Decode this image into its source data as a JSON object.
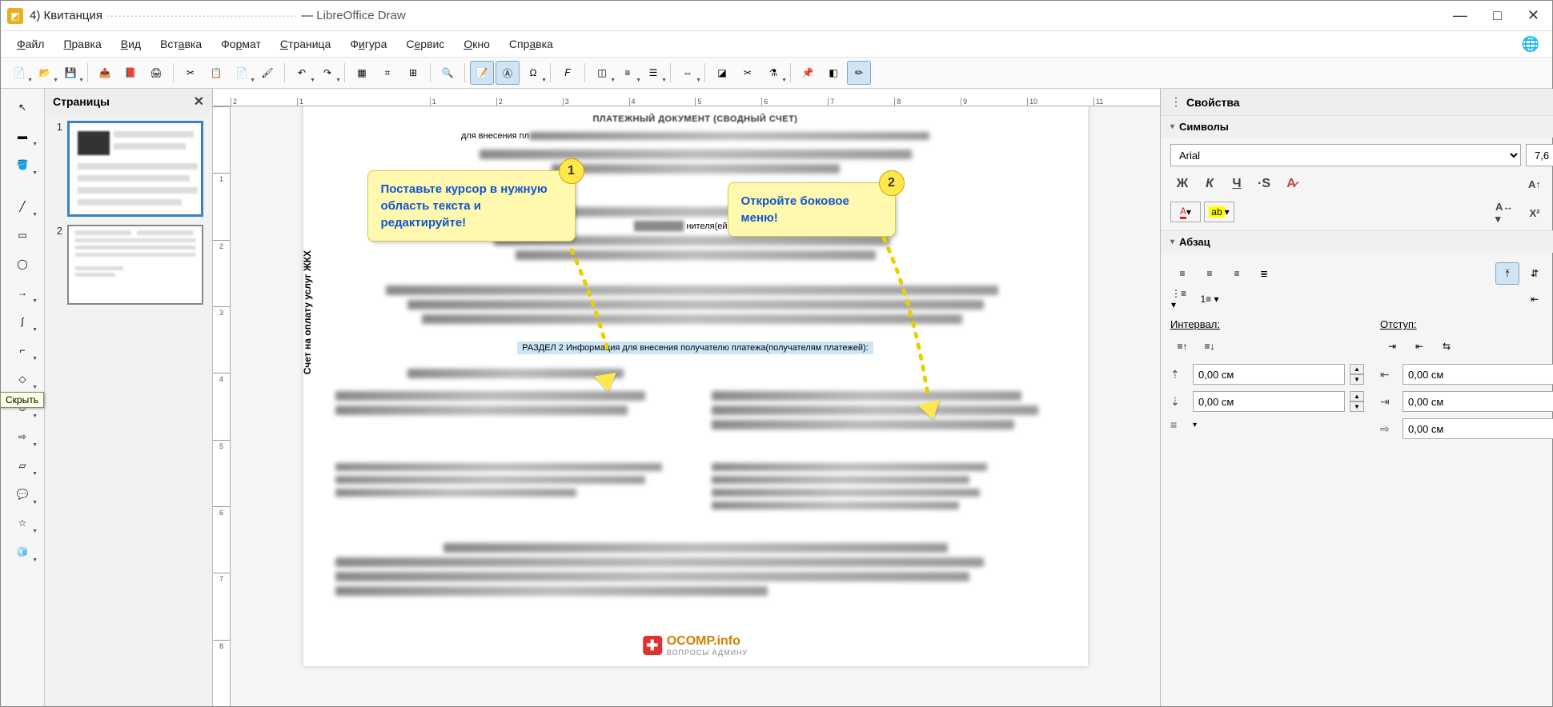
{
  "titlebar": {
    "doc_prefix": "4) Квитанция",
    "app_name": "LibreOffice Draw"
  },
  "menubar": {
    "items": [
      "Файл",
      "Правка",
      "Вид",
      "Вставка",
      "Формат",
      "Страница",
      "Фигура",
      "Сервис",
      "Окно",
      "Справка"
    ]
  },
  "pages_panel": {
    "title": "Страницы",
    "pages": [
      {
        "num": "1"
      },
      {
        "num": "2"
      }
    ]
  },
  "canvas": {
    "doc_header": "ПЛАТЕЖНЫЙ ДОКУМЕНТ (СВОДНЫЙ СЧЕТ)",
    "doc_sub": "для внесения пл",
    "vertical_label": "Счет на оплату услуг ЖКХ",
    "services_label": "нителя(ей) услуг:",
    "highlight": "РАЗДЕЛ  2 Информация для внесения получателю платежа(получателям платежей):",
    "callout1": {
      "text": "Поставьте курсор в нужную область текста и редактируйте!",
      "badge": "1"
    },
    "callout2": {
      "text": "Откройте боковое меню!",
      "badge": "2"
    },
    "watermark": {
      "main": "OCOMP.info",
      "sub": "ВОПРОСЫ АДМИНУ"
    }
  },
  "sidebar": {
    "title": "Свойства",
    "sections": {
      "symbols": {
        "title": "Символы",
        "font_name": "Arial",
        "font_size": "7,6"
      },
      "paragraph": {
        "title": "Абзац",
        "interval_label": "Интервал:",
        "indent_label": "Отступ:",
        "spacing_above": "0,00 см",
        "spacing_below": "0,00 см",
        "indent_before": "0,00 см",
        "indent_after": "0,00 см",
        "indent_first": "0,00 см"
      }
    },
    "tooltip_hide": "Скрыть"
  },
  "ruler": {
    "h": [
      "2",
      "1",
      "",
      "1",
      "2",
      "3",
      "4",
      "5",
      "6",
      "7",
      "8",
      "9",
      "10",
      "11"
    ],
    "v": [
      "",
      "1",
      "2",
      "3",
      "4",
      "5",
      "6",
      "7",
      "8"
    ]
  },
  "icons": {
    "bold": "Ж",
    "italic": "К",
    "underline": "Ч",
    "strike": "S",
    "clear": "A"
  }
}
